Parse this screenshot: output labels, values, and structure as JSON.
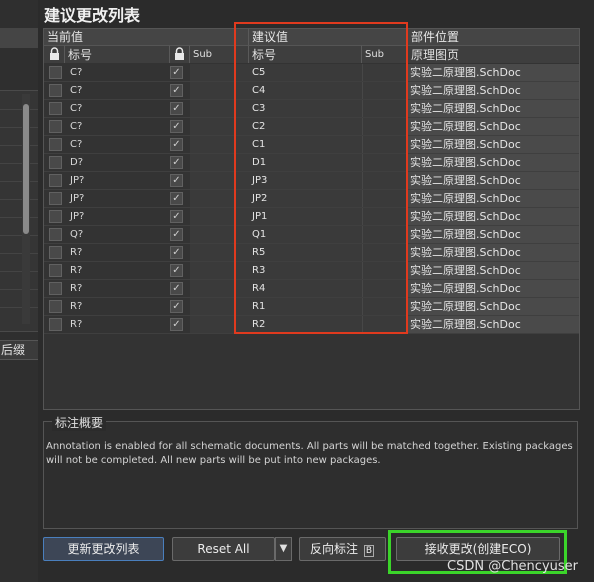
{
  "dialog": {
    "title": "建议更改列表"
  },
  "left_panel": {
    "suffix_label": "后缀"
  },
  "grid": {
    "group_current": "当前值",
    "group_suggested": "建议值",
    "group_location": "部件位置",
    "col_current_designator": "标号",
    "col_current_sub": "Sub",
    "col_suggested_designator": "标号",
    "col_suggested_sub": "Sub",
    "col_location": "原理图页",
    "rows": [
      {
        "current": "C?",
        "checked": "✓",
        "suggested": "C5",
        "location": "实验二原理图.SchDoc"
      },
      {
        "current": "C?",
        "checked": "✓",
        "suggested": "C4",
        "location": "实验二原理图.SchDoc"
      },
      {
        "current": "C?",
        "checked": "✓",
        "suggested": "C3",
        "location": "实验二原理图.SchDoc"
      },
      {
        "current": "C?",
        "checked": "✓",
        "suggested": "C2",
        "location": "实验二原理图.SchDoc"
      },
      {
        "current": "C?",
        "checked": "✓",
        "suggested": "C1",
        "location": "实验二原理图.SchDoc"
      },
      {
        "current": "D?",
        "checked": "✓",
        "suggested": "D1",
        "location": "实验二原理图.SchDoc"
      },
      {
        "current": "JP?",
        "checked": "✓",
        "suggested": "JP3",
        "location": "实验二原理图.SchDoc"
      },
      {
        "current": "JP?",
        "checked": "✓",
        "suggested": "JP2",
        "location": "实验二原理图.SchDoc"
      },
      {
        "current": "JP?",
        "checked": "✓",
        "suggested": "JP1",
        "location": "实验二原理图.SchDoc"
      },
      {
        "current": "Q?",
        "checked": "✓",
        "suggested": "Q1",
        "location": "实验二原理图.SchDoc"
      },
      {
        "current": "R?",
        "checked": "✓",
        "suggested": "R5",
        "location": "实验二原理图.SchDoc"
      },
      {
        "current": "R?",
        "checked": "✓",
        "suggested": "R3",
        "location": "实验二原理图.SchDoc"
      },
      {
        "current": "R?",
        "checked": "✓",
        "suggested": "R4",
        "location": "实验二原理图.SchDoc"
      },
      {
        "current": "R?",
        "checked": "✓",
        "suggested": "R1",
        "location": "实验二原理图.SchDoc"
      },
      {
        "current": "R?",
        "checked": "✓",
        "suggested": "R2",
        "location": "实验二原理图.SchDoc"
      }
    ]
  },
  "summary": {
    "title": "标注概要",
    "text": "Annotation is enabled for all schematic documents. All parts will be matched together. Existing packages will not be completed. All new parts will be put into new packages."
  },
  "buttons": {
    "update_list": "更新更改列表",
    "reset_all": "Reset All",
    "back_annotate": "反向标注",
    "back_annotate_shortcut": "B",
    "accept_changes": "接收更改(创建ECO)"
  },
  "watermark": "CSDN @Chencyuser",
  "colors": {
    "highlight_red": "#e03a1e",
    "highlight_green": "#3bd42a",
    "primary_border": "#4a7fbd"
  }
}
